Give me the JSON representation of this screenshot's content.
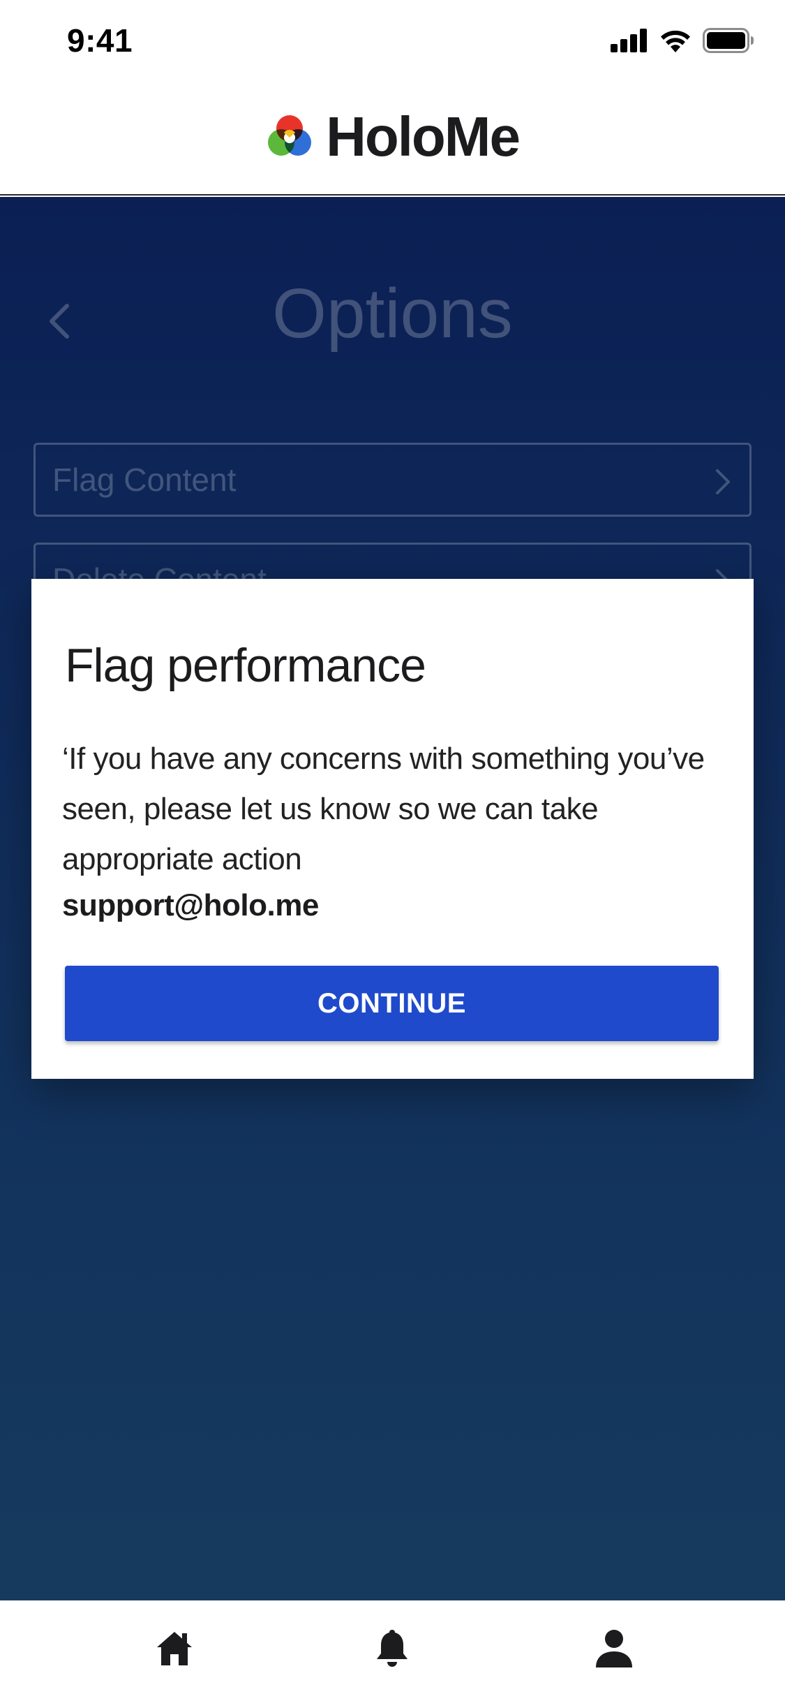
{
  "status_bar": {
    "time": "9:41",
    "icons": [
      "cellular-signal-icon",
      "wifi-icon",
      "battery-icon"
    ]
  },
  "header": {
    "brand_name": "HoloMe",
    "logo_icon": "holome-logo-icon"
  },
  "background_screen": {
    "title": "Options",
    "back_icon": "chevron-left-icon",
    "options": [
      {
        "label": "Flag Content",
        "icon": "chevron-right-icon"
      },
      {
        "label": "Delete Content",
        "icon": "chevron-right-icon"
      }
    ]
  },
  "dialog": {
    "title": "Flag performance",
    "message": "‘If you have any concerns with something you’ve seen, please let us know so we can take appropriate action",
    "email": "support@holo.me",
    "button_label": "CONTINUE"
  },
  "tab_bar": {
    "tabs": [
      {
        "icon": "home-icon"
      },
      {
        "icon": "bell-icon"
      },
      {
        "icon": "profile-icon"
      }
    ]
  },
  "colors": {
    "primary": "#1f4acb",
    "overlay_top": "#0b1f54",
    "overlay_bottom": "#163a5e"
  }
}
